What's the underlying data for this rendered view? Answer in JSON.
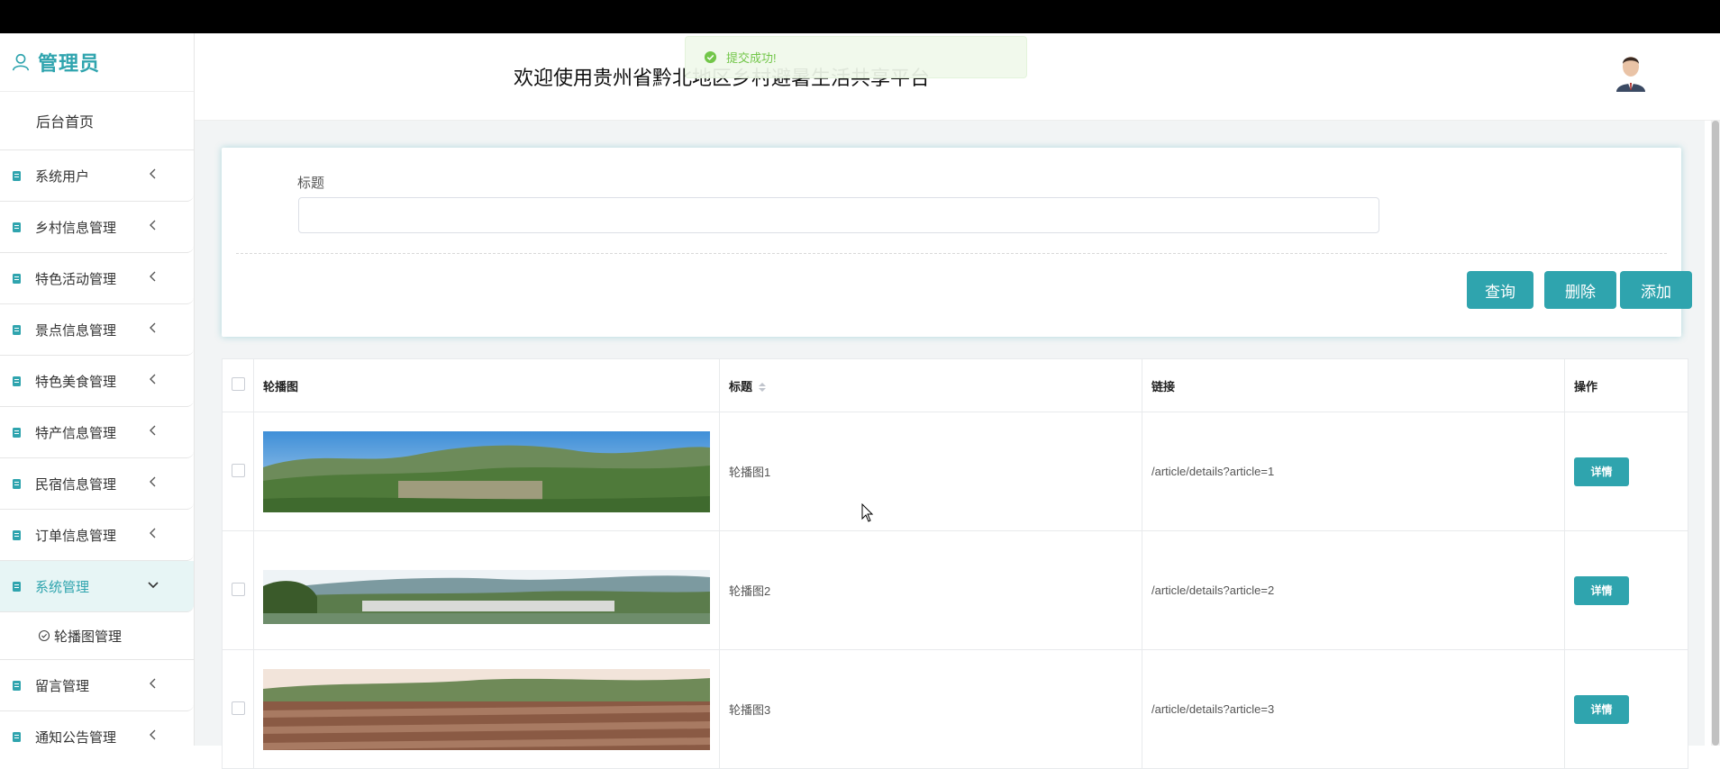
{
  "sidebar": {
    "brand": "管理员",
    "home": "后台首页",
    "items": [
      {
        "label": "系统用户"
      },
      {
        "label": "乡村信息管理"
      },
      {
        "label": "特色活动管理"
      },
      {
        "label": "景点信息管理"
      },
      {
        "label": "特色美食管理"
      },
      {
        "label": "特产信息管理"
      },
      {
        "label": "民宿信息管理"
      },
      {
        "label": "订单信息管理"
      },
      {
        "label": "系统管理"
      },
      {
        "label": "留言管理"
      },
      {
        "label": "通知公告管理"
      }
    ],
    "submenu": {
      "label": "轮播图管理"
    }
  },
  "header": {
    "title": "欢迎使用贵州省黔北地区乡村避暑生活共享平台"
  },
  "toast": {
    "message": "提交成功!"
  },
  "search": {
    "title_label": "标题",
    "title_value": "",
    "buttons": {
      "query": "查询",
      "delete": "删除",
      "add": "添加"
    }
  },
  "table": {
    "columns": [
      "轮播图",
      "标题",
      "链接",
      "操作"
    ],
    "rows": [
      {
        "title": "轮播图1",
        "link": "/article/details?article=1",
        "action": "详情"
      },
      {
        "title": "轮播图2",
        "link": "/article/details?article=2",
        "action": "详情"
      },
      {
        "title": "轮播图3",
        "link": "/article/details?article=3",
        "action": "详情"
      }
    ]
  },
  "colors": {
    "accent": "#2fa4ae",
    "topbar": "#000000",
    "success": "#67c23a"
  }
}
